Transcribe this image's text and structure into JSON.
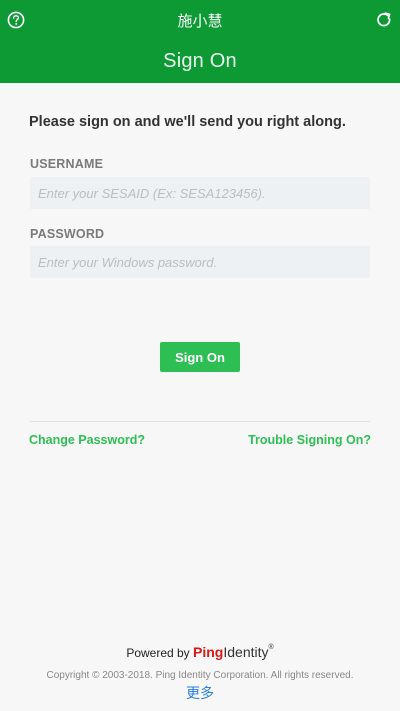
{
  "topbar": {
    "title": "施小慧",
    "help_icon": "help-circle-icon",
    "refresh_icon": "refresh-icon"
  },
  "subbar": {
    "heading": "Sign On"
  },
  "form": {
    "instruction": "Please sign on and we'll send you right along.",
    "username_label": "USERNAME",
    "username_placeholder": "Enter your SESAID (Ex: SESA123456).",
    "username_value": "",
    "password_label": "PASSWORD",
    "password_placeholder": "Enter your Windows password.",
    "password_value": "",
    "submit_label": "Sign On"
  },
  "links": {
    "change_password": "Change Password?",
    "trouble": "Trouble Signing On?"
  },
  "footer": {
    "powered_by": "Powered by",
    "brand_ping": "Ping",
    "brand_identity": "Identity",
    "brand_reg": "®",
    "copyright": "Copyright © 2003-2018. Ping Identity Corporation. All rights reserved.",
    "more": "更多"
  },
  "colors": {
    "header_green": "#0d9a35",
    "accent_green": "#2ebf54",
    "brand_red": "#d71a1a",
    "link_blue": "#2a7de1"
  }
}
